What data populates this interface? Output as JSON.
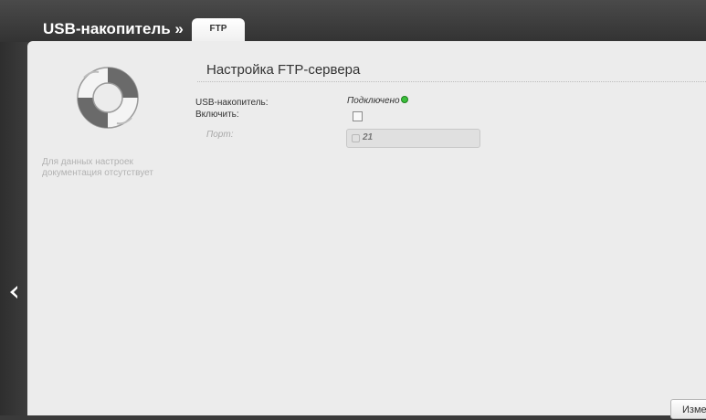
{
  "header": {
    "breadcrumb": "USB-накопитель »",
    "active_tab": "FTP"
  },
  "sidebar": {
    "help_note": "Для данных настроек документация отсутствует"
  },
  "section": {
    "title": "Настройка FTP-сервера",
    "usb_label": "USB-накопитель:",
    "usb_status": "Подключено",
    "enable_label": "Включить:",
    "port_label": "Порт:",
    "port_value": "21"
  },
  "actions": {
    "apply_label": "Изме"
  },
  "colors": {
    "status_connected": "#3bbf3b",
    "accent_dark": "#3a3a3a"
  }
}
